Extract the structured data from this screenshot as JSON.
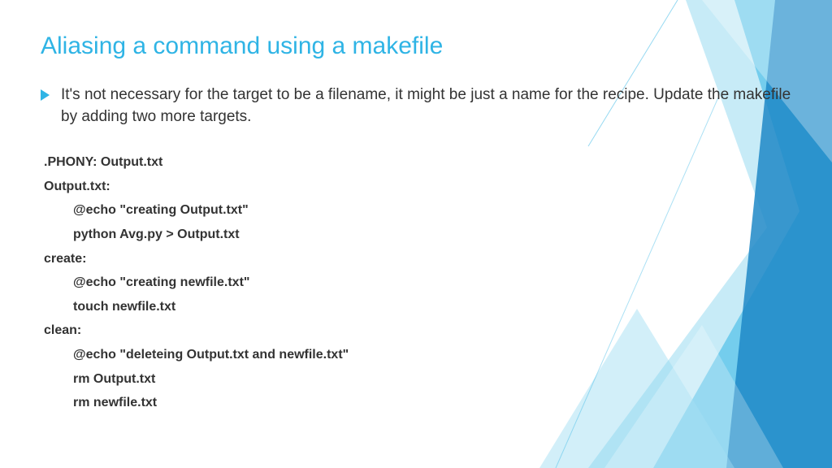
{
  "title": "Aliasing a command using  a makefile",
  "bullet": "It's not necessary for the target to be a filename, it might be just a name for the recipe. Update the makefile by adding two more targets.",
  "code": {
    "l1": ".PHONY: Output.txt",
    "l2": "Output.txt:",
    "l3": "@echo \"creating Output.txt\"",
    "l4": "python Avg.py > Output.txt",
    "l5": "create:",
    "l6": "@echo \"creating newfile.txt\"",
    "l7": "touch newfile.txt",
    "l8": "clean:",
    "l9": "@echo \"deleteing Output.txt and newfile.txt\"",
    "l10": "rm Output.txt",
    "l11": "rm newfile.txt"
  }
}
